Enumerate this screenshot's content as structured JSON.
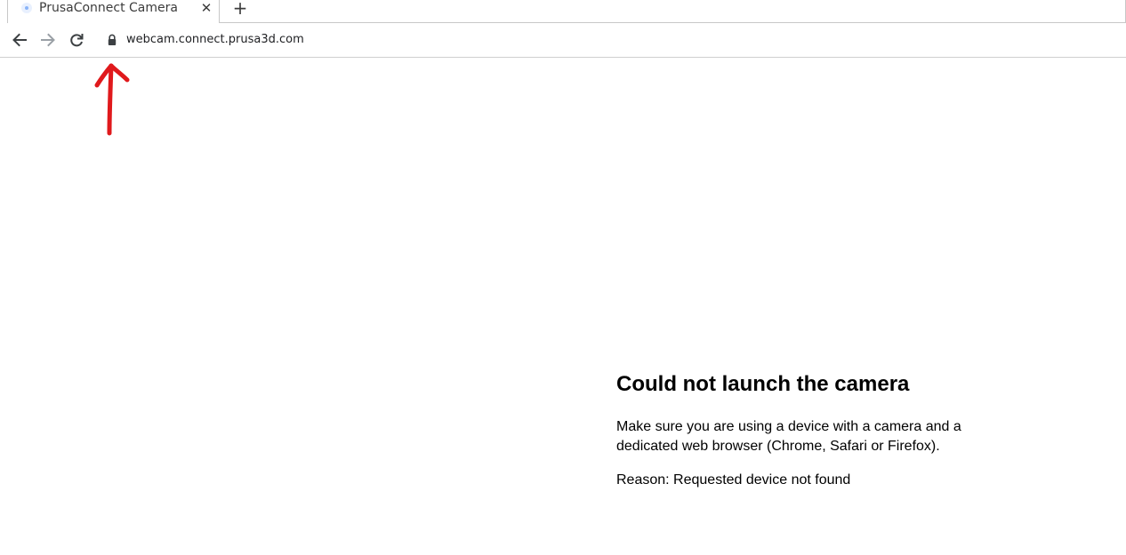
{
  "browser": {
    "tab": {
      "title": "PrusaConnect Camera",
      "close_label": "✕",
      "favicon": "prusa-favicon-icon"
    },
    "new_tab_label": "+",
    "toolbar": {
      "back_icon": "back-arrow-icon",
      "forward_icon": "forward-arrow-icon",
      "reload_icon": "reload-icon",
      "lock_icon": "lock-icon"
    },
    "address_bar": {
      "url": "webcam.connect.prusa3d.com"
    }
  },
  "annotation": {
    "icon": "red-up-arrow-icon",
    "color": "#e0191c"
  },
  "page": {
    "error": {
      "heading": "Could not launch the camera",
      "description": "Make sure you are using a device with a camera and a dedicated web browser (Chrome, Safari or Firefox).",
      "reason": "Reason: Requested device not found"
    }
  }
}
